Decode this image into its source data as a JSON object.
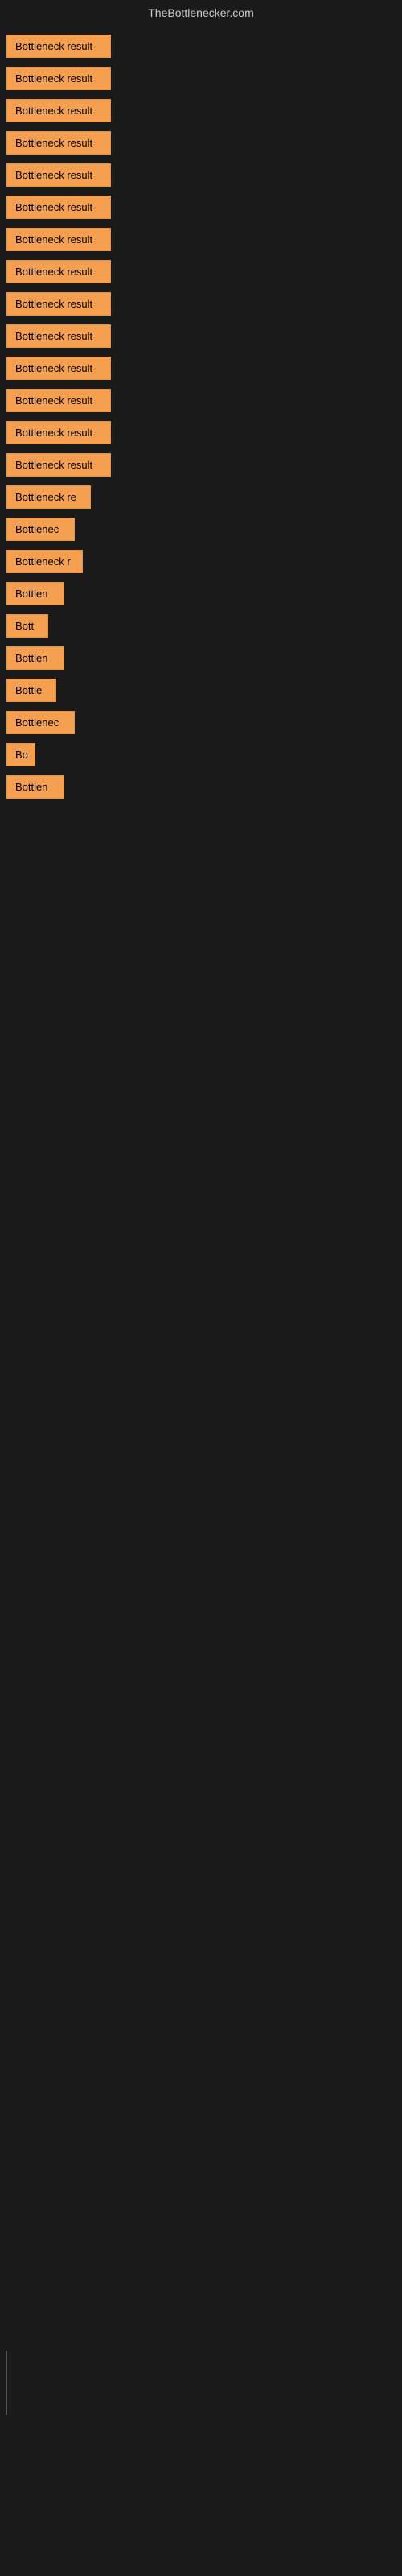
{
  "header": {
    "title": "TheBottlenecker.com"
  },
  "items": [
    {
      "id": 1,
      "label": "Bottleneck result",
      "width": 130
    },
    {
      "id": 2,
      "label": "Bottleneck result",
      "width": 130
    },
    {
      "id": 3,
      "label": "Bottleneck result",
      "width": 130
    },
    {
      "id": 4,
      "label": "Bottleneck result",
      "width": 130
    },
    {
      "id": 5,
      "label": "Bottleneck result",
      "width": 130
    },
    {
      "id": 6,
      "label": "Bottleneck result",
      "width": 130
    },
    {
      "id": 7,
      "label": "Bottleneck result",
      "width": 130
    },
    {
      "id": 8,
      "label": "Bottleneck result",
      "width": 130
    },
    {
      "id": 9,
      "label": "Bottleneck result",
      "width": 130
    },
    {
      "id": 10,
      "label": "Bottleneck result",
      "width": 130
    },
    {
      "id": 11,
      "label": "Bottleneck result",
      "width": 130
    },
    {
      "id": 12,
      "label": "Bottleneck result",
      "width": 130
    },
    {
      "id": 13,
      "label": "Bottleneck result",
      "width": 130
    },
    {
      "id": 14,
      "label": "Bottleneck result",
      "width": 130
    },
    {
      "id": 15,
      "label": "Bottleneck re",
      "width": 105
    },
    {
      "id": 16,
      "label": "Bottlenec",
      "width": 85
    },
    {
      "id": 17,
      "label": "Bottleneck r",
      "width": 95
    },
    {
      "id": 18,
      "label": "Bottlen",
      "width": 72
    },
    {
      "id": 19,
      "label": "Bott",
      "width": 52
    },
    {
      "id": 20,
      "label": "Bottlen",
      "width": 72
    },
    {
      "id": 21,
      "label": "Bottle",
      "width": 62
    },
    {
      "id": 22,
      "label": "Bottlenec",
      "width": 85
    },
    {
      "id": 23,
      "label": "Bo",
      "width": 36
    },
    {
      "id": 24,
      "label": "Bottlen",
      "width": 72
    }
  ],
  "colors": {
    "background": "#1a1a1a",
    "badge_bg": "#f5a050",
    "badge_border": "#e8943a",
    "title_color": "#cccccc",
    "badge_text": "#000000"
  }
}
